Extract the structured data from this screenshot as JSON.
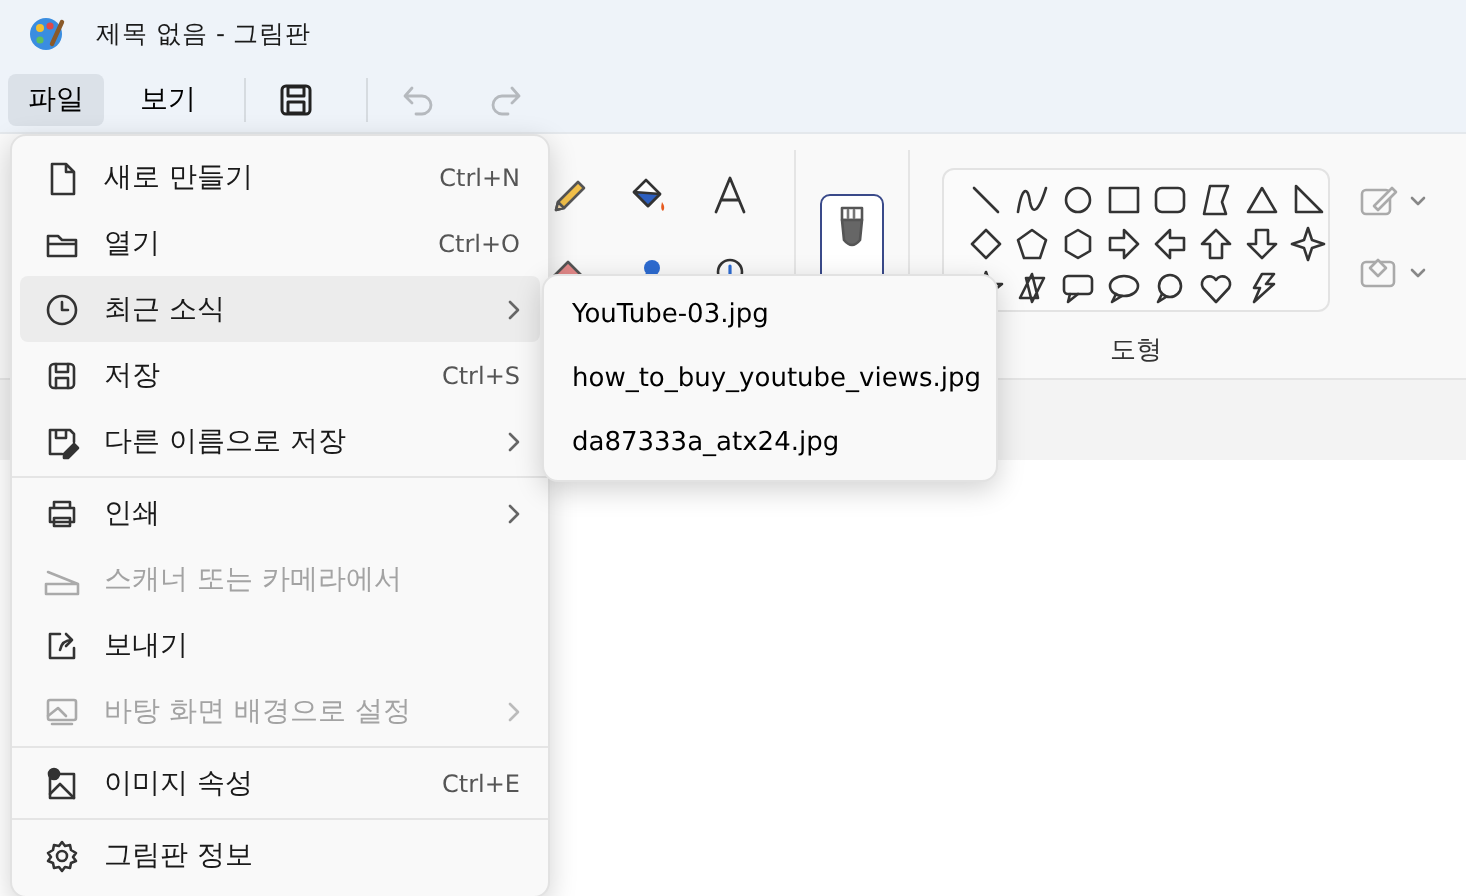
{
  "window": {
    "title": "제목 없음 - 그림판"
  },
  "menubar": {
    "items": [
      {
        "label": "파일",
        "selected": true
      },
      {
        "label": "보기",
        "selected": false
      }
    ],
    "tools": [
      {
        "kind": "save",
        "disabled": false
      },
      {
        "kind": "undo",
        "disabled": true
      },
      {
        "kind": "redo",
        "disabled": true
      }
    ]
  },
  "ribbon": {
    "shapes_label": "도형"
  },
  "file_menu": {
    "items": [
      {
        "label": "새로 만들기",
        "shortcut": "Ctrl+N",
        "submenu": false,
        "disabled": false,
        "selected": false,
        "separator_before": false
      },
      {
        "label": "열기",
        "shortcut": "Ctrl+O",
        "submenu": false,
        "disabled": false,
        "selected": false,
        "separator_before": false
      },
      {
        "label": "최근 소식",
        "submenu": true,
        "disabled": false,
        "selected": true,
        "separator_before": false
      },
      {
        "label": "저장",
        "shortcut": "Ctrl+S",
        "submenu": false,
        "disabled": false,
        "selected": false,
        "separator_before": false
      },
      {
        "label": "다른 이름으로 저장",
        "submenu": true,
        "disabled": false,
        "selected": false,
        "separator_before": false
      },
      {
        "label": "인쇄",
        "submenu": true,
        "disabled": false,
        "selected": false,
        "separator_before": true
      },
      {
        "label": "스캐너 또는 카메라에서",
        "submenu": false,
        "disabled": true,
        "selected": false,
        "separator_before": false
      },
      {
        "label": "보내기",
        "submenu": false,
        "disabled": false,
        "selected": false,
        "separator_before": false
      },
      {
        "label": "바탕 화면 배경으로 설정",
        "submenu": true,
        "disabled": true,
        "selected": false,
        "separator_before": false
      },
      {
        "label": "이미지 속성",
        "shortcut": "Ctrl+E",
        "submenu": false,
        "disabled": false,
        "selected": false,
        "separator_before": true
      },
      {
        "label": "그림판 정보",
        "submenu": false,
        "disabled": false,
        "selected": false,
        "separator_before": true
      }
    ]
  },
  "recent_submenu": {
    "items": [
      {
        "label": "YouTube-03.jpg",
        "selected": false
      },
      {
        "label": "how_to_buy_youtube_views.jpg",
        "selected": false
      },
      {
        "label": "da87333a_atx24.jpg",
        "selected": false
      }
    ]
  }
}
